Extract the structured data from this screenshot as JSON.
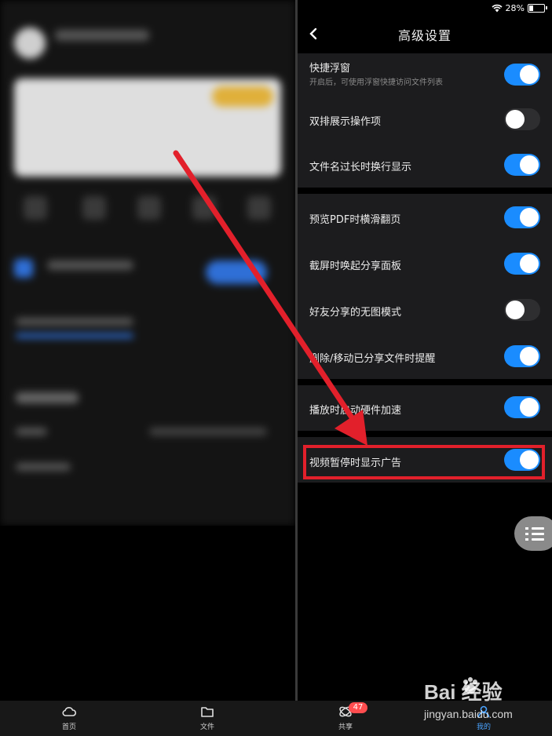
{
  "status_bar": {
    "battery": "28%"
  },
  "header": {
    "back_icon": "chevron-left-icon",
    "title": "高级设置"
  },
  "settings": [
    {
      "label": "快捷浮窗",
      "sub": "开启后，可使用浮窗快捷访问文件列表",
      "on": true
    },
    {
      "label": "双排展示操作项",
      "on": false
    },
    {
      "label": "文件名过长时换行显示",
      "on": true
    },
    {
      "label": "预览PDF时横滑翻页",
      "on": true
    },
    {
      "label": "截屏时唤起分享面板",
      "on": true
    },
    {
      "label": "好友分享的无图模式",
      "on": false
    },
    {
      "label": "删除/移动已分享文件时提醒",
      "on": true
    },
    {
      "label": "播放时启动硬件加速",
      "on": true
    },
    {
      "label": "视频暂停时显示广告",
      "on": true
    }
  ],
  "floating_menu": {
    "icon": "list-icon"
  },
  "tab_bar": {
    "tabs": [
      {
        "label": "首页",
        "icon": "cloud-icon"
      },
      {
        "label": "文件",
        "icon": "folder-icon"
      },
      {
        "label": "共享",
        "icon": "share-icon",
        "badge": "47"
      },
      {
        "label": "我的",
        "icon": "profile-icon"
      }
    ]
  },
  "watermark": {
    "brand": "Bai  经验",
    "url": "jingyan.baidu.com"
  },
  "colors": {
    "toggle_on": "#1a8cff",
    "highlight": "#e2202b",
    "badge": "#ff4d4f"
  }
}
